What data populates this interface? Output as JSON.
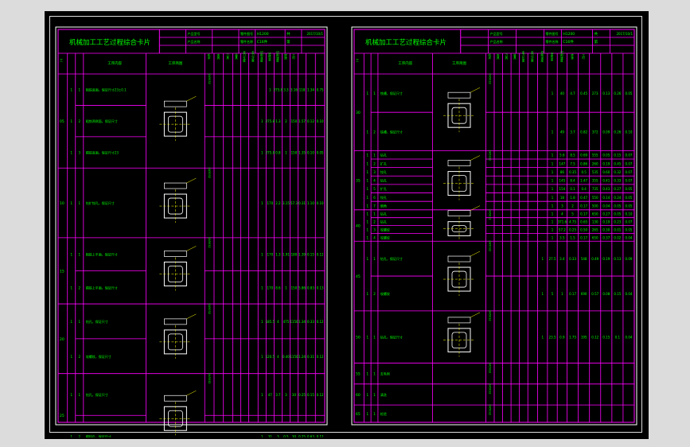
{
  "left_sheet": {
    "title": "机械加工工艺过程综合卡片",
    "header": {
      "label1": "产品型号",
      "label2": "零件图号",
      "label3": "产品名称",
      "label4": "零件名称",
      "part_no": "H1200",
      "date": "2017/10/1",
      "material": "C16件",
      "sheet_word": "共",
      "page_word": "第"
    },
    "columns": [
      "工序号",
      "安装",
      "工步",
      "工序内容",
      "工序简图",
      "机床",
      "夹具",
      "刀具",
      "量具",
      "走刀长度",
      "走刀次数",
      "切削深度",
      "进给量",
      "切削速度",
      "转速",
      "工时"
    ],
    "operations": [
      {
        "no": "05",
        "steps": [
          {
            "inst": "1",
            "step": "1",
            "text": "粗铣底面，保证尺寸23±0.1",
            "vals": [
              "1",
              "275.8",
              "3.3",
              "3.16",
              "118",
              "1.34",
              "0.75"
            ]
          },
          {
            "inst": "1",
            "step": "2",
            "text": "粗铣两侧面，保证尺寸",
            "vals": [
              "1",
              "275.8",
              "1.3",
              "2",
              "150",
              "1.57",
              "0.12",
              "0.10"
            ]
          },
          {
            "inst": "1",
            "step": "3",
            "text": "精铣底面，保证尺寸23",
            "vals": [
              "1",
              "275.8",
              "0.8",
              "1",
              "150",
              "1.35",
              "0.10",
              "0.05"
            ]
          }
        ]
      },
      {
        "no": "10",
        "steps": [
          {
            "inst": "1",
            "step": "1",
            "text": "钻扩铰孔，保证尺寸",
            "vals": [
              "1",
              "170",
              "2.2",
              "3.15",
              "57.3",
              "0.31",
              "1.10",
              "0.10"
            ]
          }
        ]
      },
      {
        "no": "15",
        "steps": [
          {
            "inst": "1",
            "step": "1",
            "text": "粗铣上平面，保证尺寸",
            "vals": [
              "1",
              "170",
              "1.3",
              "1.91",
              "180",
              "1.39",
              "0.15",
              "0.12"
            ]
          },
          {
            "inst": "1",
            "step": "2",
            "text": "精铣上平面，保证尺寸",
            "vals": [
              "1",
              "170",
              "8.6",
              "1",
              "150",
              "5.86",
              "0.83",
              "0.13"
            ]
          }
        ]
      },
      {
        "no": "20",
        "steps": [
          {
            "inst": "1",
            "step": "1",
            "text": "钻孔，保证尺寸",
            "vals": [
              "1",
              "185.5",
              "4",
              "475",
              "1150",
              "1.34",
              "0.33",
              "0.12"
            ]
          },
          {
            "inst": "1",
            "step": "2",
            "text": "攻螺纹，保证尺寸",
            "vals": [
              "1",
              "120.5",
              "4",
              "0.40",
              "1150",
              "1.24",
              "0.31",
              "0.12"
            ]
          }
        ]
      },
      {
        "no": "25",
        "steps": [
          {
            "inst": "1",
            "step": "1",
            "text": "钻孔，保证尺寸",
            "vals": [
              "1",
              "47",
              "3.7",
              "3",
              "30",
              "0.25",
              "0.15",
              "0.12"
            ]
          },
          {
            "inst": "1",
            "step": "2",
            "text": "精铰孔，保证尺寸",
            "vals": [
              "1",
              "31",
              "3",
              "0.5",
              "30",
              "0.25",
              "0.63",
              "0.12"
            ]
          }
        ]
      }
    ]
  },
  "right_sheet": {
    "title": "机械加工工艺过程综合卡片",
    "header": {
      "label1": "产品型号",
      "label2": "零件图号",
      "label3": "产品名称",
      "label4": "零件名称",
      "part_no": "H1200",
      "date": "2017/10/1",
      "material": "C16件",
      "sheet_word": "共",
      "page_word": "第"
    },
    "operations": [
      {
        "no": "30",
        "steps": [
          {
            "inst": "1",
            "step": "1",
            "text": "铣槽，保证尺寸",
            "vals": [
              "1",
              "40",
              "4.7",
              "0.45",
              "273",
              "0.13",
              "0.26",
              "0.05"
            ]
          },
          {
            "inst": "1",
            "step": "2",
            "text": "铣槽，保证尺寸",
            "vals": [
              "1",
              "49",
              "3.7",
              "0.82",
              "372",
              "0.09",
              "0.26",
              "0.10"
            ]
          }
        ]
      },
      {
        "no": "35",
        "steps": [
          {
            "inst": "1",
            "step": "1",
            "text": "钻孔",
            "vals": [
              "1",
              "5.6",
              "8.5",
              "0.69",
              "555",
              "0.05",
              "0.15",
              "0.07"
            ]
          },
          {
            "inst": "1",
            "step": "2",
            "text": "扩孔",
            "vals": [
              "1",
              "147",
              "7.5",
              "0.86",
              "260",
              "0.19",
              "0.45",
              "0.07"
            ]
          },
          {
            "inst": "1",
            "step": "3",
            "text": "铰孔",
            "vals": [
              "1",
              "86",
              "0.35",
              "0.5",
              "535",
              "0.60",
              "0.32",
              "0.07"
            ]
          },
          {
            "inst": "1",
            "step": "4",
            "text": "钻孔",
            "vals": [
              "1",
              "145",
              "8.4",
              "1.47",
              "355",
              "0.41",
              "0.33",
              "0.07"
            ]
          },
          {
            "inst": "1",
            "step": "5",
            "text": "扩孔",
            "vals": [
              "1",
              "154",
              "0.1",
              "0.4",
              "735",
              "0.43",
              "0.27",
              "0.05"
            ]
          },
          {
            "inst": "1",
            "step": "6",
            "text": "铰孔",
            "vals": [
              "1",
              "18",
              "1.8",
              "0.47",
              "550",
              "0.14",
              "0.24",
              "0.05"
            ]
          },
          {
            "inst": "1",
            "step": "7",
            "text": "倒角",
            "vals": [
              "1",
              "3",
              "2",
              "0.17",
              "500",
              "0.04",
              "0.05",
              "0.05"
            ]
          }
        ]
      },
      {
        "no": "40",
        "steps": [
          {
            "inst": "1",
            "step": "1",
            "text": "钻孔",
            "vals": [
              "1",
              "4",
              "5",
              "0.17",
              "650",
              "0.27",
              "0.05",
              "0.10"
            ]
          },
          {
            "inst": "1",
            "step": "2",
            "text": "钻孔",
            "vals": [
              "1",
              "371.6",
              "4.75",
              "0.65",
              "130",
              "0.19",
              "0.23",
              "0.07"
            ]
          },
          {
            "inst": "1",
            "step": "3",
            "text": "攻螺纹",
            "vals": [
              "1",
              "57.2",
              "0.25",
              "0.50",
              "265",
              "0.30",
              "0.01",
              "0.05"
            ]
          },
          {
            "inst": "1",
            "step": "4",
            "text": "攻螺纹",
            "vals": [
              "1",
              "3.5",
              "1.5",
              "0.17",
              "650",
              "0.37",
              "0.02",
              "0.04"
            ]
          }
        ]
      },
      {
        "no": "45",
        "steps": [
          {
            "inst": "1",
            "step": "1",
            "text": "钻孔，保证尺寸",
            "vals": [
              "1",
              "27.5",
              "3.4",
              "0.33",
              "548",
              "0.49",
              "0.19",
              "0.13",
              "0.09"
            ]
          },
          {
            "inst": "1",
            "step": "2",
            "text": "攻螺纹",
            "vals": [
              "1",
              "5",
              "1",
              "0.17",
              "690",
              "0.57",
              "0.08",
              "0.15",
              "0.04"
            ]
          }
        ]
      },
      {
        "no": "50",
        "steps": [
          {
            "inst": "1",
            "step": "1",
            "text": "钻孔，保证尺寸",
            "vals": [
              "1",
              "23.5",
              "0.9",
              "1.75",
              "195",
              "0.12",
              "0.15",
              "0.1",
              "0.04"
            ]
          }
        ]
      },
      {
        "no": "55",
        "steps": [
          {
            "inst": "1",
            "step": "1",
            "text": "去毛刺",
            "vals": []
          }
        ]
      },
      {
        "no": "60",
        "steps": [
          {
            "inst": "1",
            "step": "1",
            "text": "清洗",
            "vals": []
          }
        ]
      },
      {
        "no": "65",
        "steps": [
          {
            "inst": "1",
            "step": "1",
            "text": "检验",
            "vals": []
          }
        ]
      }
    ]
  },
  "colors": {
    "frame": "#ff00ff",
    "text": "#00ff00",
    "sketch": "#ffffff",
    "accent": "#ffff00",
    "background": "#000000"
  }
}
